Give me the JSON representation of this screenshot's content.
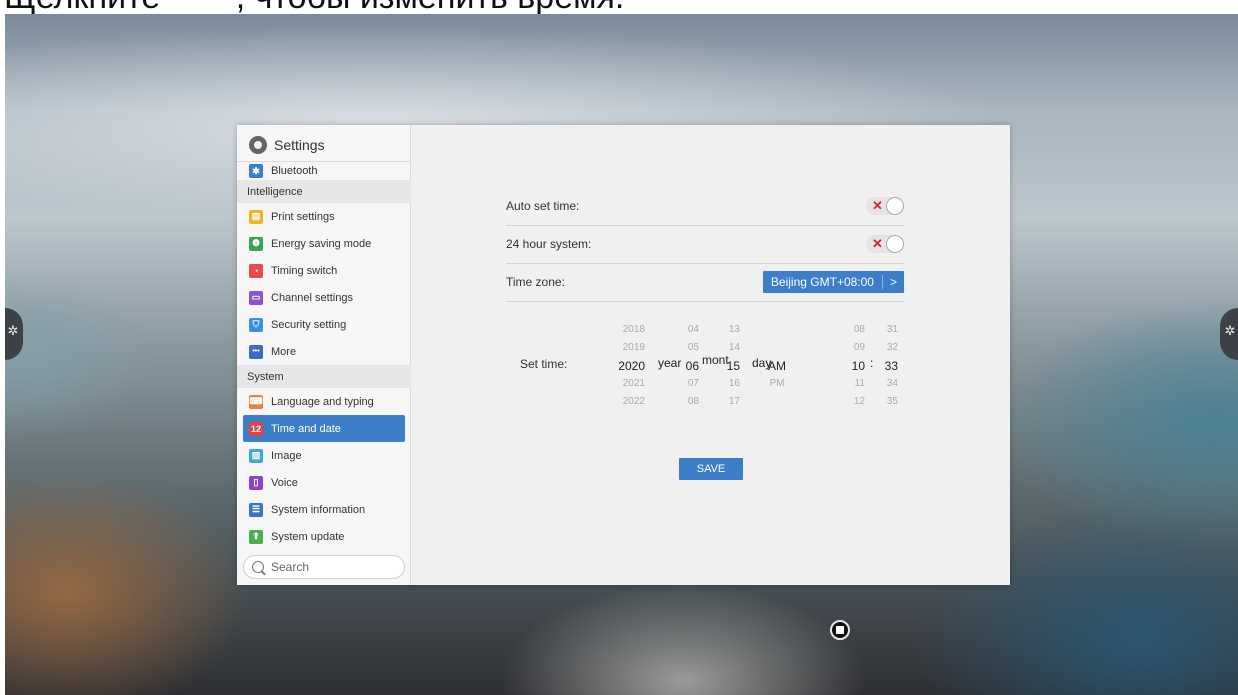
{
  "caption": "Щелкните        , чтобы изменить время.",
  "sidebar": {
    "title": "Settings",
    "items": [
      {
        "type": "item",
        "label": "Bluetooth",
        "icon": "bluetooth-icon",
        "color": "#3b7fd0",
        "glyph": "✱"
      },
      {
        "type": "section",
        "label": "Intelligence"
      },
      {
        "type": "item",
        "label": "Print settings",
        "icon": "print-icon",
        "color": "#f0b323",
        "glyph": "▤"
      },
      {
        "type": "item",
        "label": "Energy saving mode",
        "icon": "leaf-icon",
        "color": "#3aa35a",
        "glyph": "❶"
      },
      {
        "type": "item",
        "label": "Timing switch",
        "icon": "clock-icon",
        "color": "#e84b4b",
        "glyph": "◔"
      },
      {
        "type": "item",
        "label": "Channel settings",
        "icon": "monitor-icon",
        "color": "#8a55c9",
        "glyph": "▭"
      },
      {
        "type": "item",
        "label": "Security setting",
        "icon": "shield-icon",
        "color": "#3a8fe0",
        "glyph": "⛉"
      },
      {
        "type": "item",
        "label": "More",
        "icon": "more-icon",
        "color": "#3d6cc4",
        "glyph": "•••"
      },
      {
        "type": "section",
        "label": "System"
      },
      {
        "type": "item",
        "label": "Language and typing",
        "icon": "keyboard-icon",
        "color": "#e8823a",
        "glyph": "⌨"
      },
      {
        "type": "item",
        "label": "Time and date",
        "icon": "calendar-icon",
        "color": "#e0463f",
        "glyph": "12",
        "active": true
      },
      {
        "type": "item",
        "label": "Image",
        "icon": "image-icon",
        "color": "#3aa9e0",
        "glyph": "▨"
      },
      {
        "type": "item",
        "label": "Voice",
        "icon": "speaker-icon",
        "color": "#8a45c9",
        "glyph": "▯"
      },
      {
        "type": "item",
        "label": "System information",
        "icon": "info-icon",
        "color": "#3d74c4",
        "glyph": "☰"
      },
      {
        "type": "item",
        "label": "System update",
        "icon": "update-icon",
        "color": "#49b04a",
        "glyph": "⬆"
      }
    ],
    "search_placeholder": "Search"
  },
  "content": {
    "auto_set_time_label": "Auto set time:",
    "hour24_label": "24 hour system:",
    "timezone_label": "Time zone:",
    "timezone_value": "Beijing GMT+08:00",
    "timezone_arrow": ">",
    "toggle_off_glyph": "✕",
    "set_time_label": "Set time:",
    "pickers": {
      "year": [
        "2018",
        "2019",
        "2020",
        "2021",
        "2022"
      ],
      "month": [
        "04",
        "05",
        "06",
        "07",
        "08"
      ],
      "day": [
        "13",
        "14",
        "15",
        "16",
        "17"
      ],
      "ampm": [
        "",
        "",
        "AM",
        "PM",
        ""
      ],
      "hour": [
        "08",
        "09",
        "10",
        "11",
        "12"
      ],
      "minute": [
        "31",
        "32",
        "33",
        "34",
        "35"
      ]
    },
    "units": {
      "year": "year",
      "month": "mont",
      "day": "day",
      "sep": ":"
    },
    "save_label": "SAVE"
  }
}
